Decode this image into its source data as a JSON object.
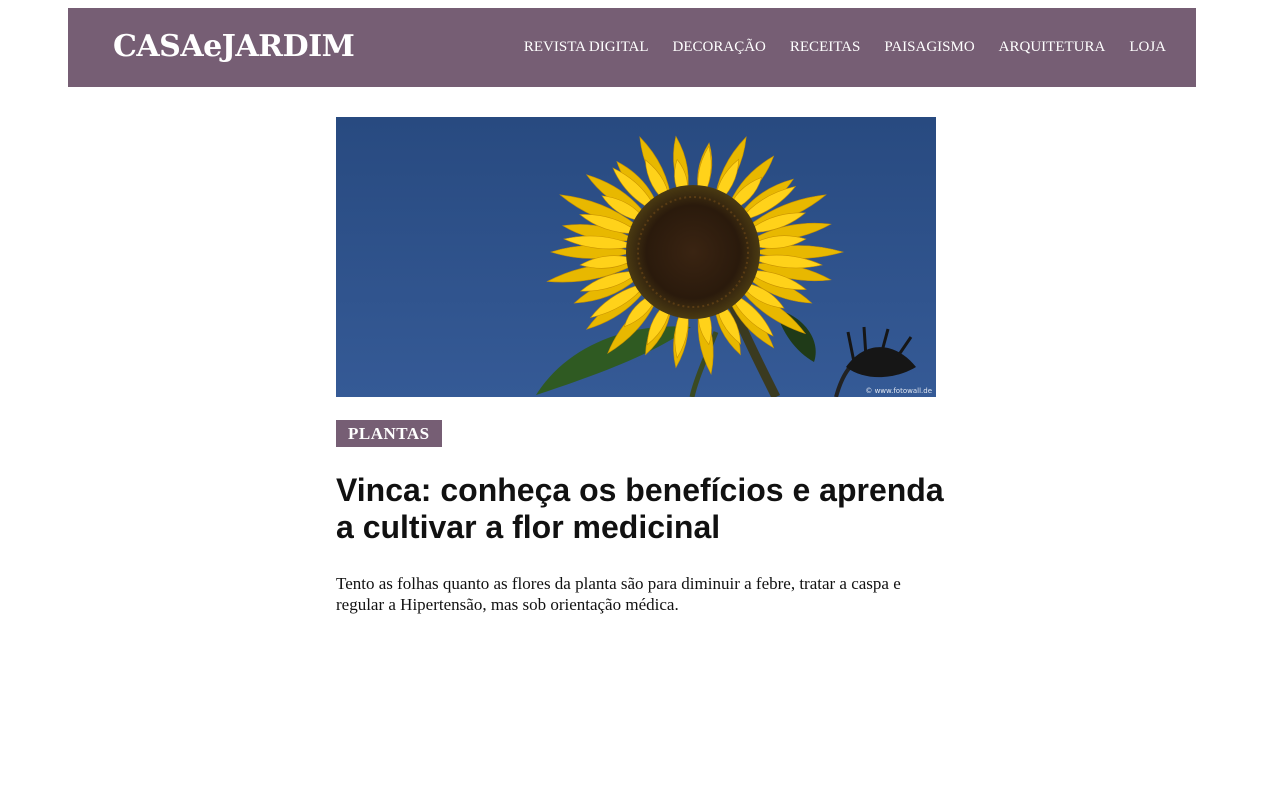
{
  "header": {
    "logo": "CASAeJARDIM",
    "background_color": "#765e74",
    "nav": [
      {
        "label": "REVISTA DIGITAL"
      },
      {
        "label": "DECORAÇÃO"
      },
      {
        "label": "RECEITAS"
      },
      {
        "label": "PAISAGISMO"
      },
      {
        "label": "ARQUITETURA"
      },
      {
        "label": "LOJA"
      }
    ]
  },
  "article": {
    "image": {
      "subject": "sunflower",
      "watermark": "© www.fotowall.de"
    },
    "category": "PLANTAS",
    "headline": "Vinca: conheça os benefícios e aprenda a cultivar a flor medicinal",
    "summary": "Tento as folhas quanto as flores da planta são para diminuir a febre, tratar a caspa e regular a Hipertensão, mas sob orientação médica."
  }
}
